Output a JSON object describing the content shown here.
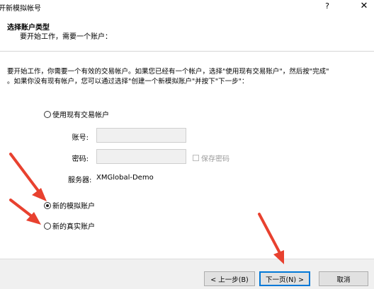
{
  "window": {
    "title": "开新模拟帐号",
    "help": "?",
    "close": "✕"
  },
  "header": {
    "title": "选择账户类型",
    "subtitle": "要开始工作，需要一个账户："
  },
  "description": {
    "line1": "要开始工作，你需要一个有效的交易帐户。如果您已经有一个帐户，选择\"使用现有交易账户\"，然后按\"完成\"",
    "line2": "。如果你没有现有帐户，您可以通过选择\"创建一个新模拟账户\"并按下\"下一步\"："
  },
  "options": {
    "existing": {
      "label": "使用现有交易帐户",
      "checked": false
    },
    "demo": {
      "label": "新的模拟账户",
      "checked": true
    },
    "real": {
      "label": "新的真实账户",
      "checked": false
    }
  },
  "fields": {
    "account_label": "账号:",
    "account_value": "",
    "password_label": "密码:",
    "password_value": "",
    "save_password_label": "保存密码",
    "server_label": "服务器:",
    "server_value": "XMGlobal-Demo"
  },
  "buttons": {
    "back": "< 上一步(B)",
    "next": "下一页(N) >",
    "cancel": "取消"
  },
  "colors": {
    "annotation_arrow": "#e8412f"
  }
}
